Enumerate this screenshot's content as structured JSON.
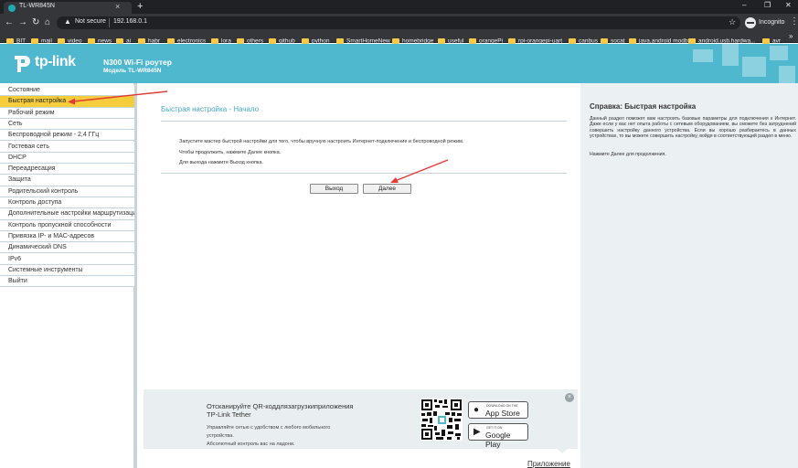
{
  "browser": {
    "tab_title": "TL-WR845N",
    "tab_close": "×",
    "new_tab": "+",
    "window_min": "–",
    "window_restore": "❐",
    "window_close": "✕",
    "security_label": "Not secure",
    "url": "192.168.0.1",
    "profile_label": "Incognito",
    "bookmarks": [
      "BIT",
      "mail",
      "video",
      "news",
      "ai",
      "habr",
      "electronics",
      "lora",
      "others",
      "github",
      "python",
      "SmartHomeNew",
      "homebridge",
      "useful",
      "orangePi",
      "rpi-orangepi-uart",
      "canbus",
      "socat",
      "java,android modbus",
      "android.usb.hardwa...",
      "avr"
    ],
    "bookmarks_more": "»"
  },
  "header": {
    "brand": "tp-link",
    "model_title": "N300 Wi-Fi роутер",
    "model_sub": "Модель TL-WR845N"
  },
  "sidebar": {
    "items": [
      {
        "label": "Состояние",
        "active": false
      },
      {
        "label": "Быстрая настройка",
        "active": true
      },
      {
        "label": "Рабочий режим",
        "active": false
      },
      {
        "label": "Сеть",
        "active": false
      },
      {
        "label": "Беспроводной режим - 2,4 ГГц",
        "active": false
      },
      {
        "label": "Гостевая сеть",
        "active": false
      },
      {
        "label": "DHCP",
        "active": false
      },
      {
        "label": "Переадресация",
        "active": false
      },
      {
        "label": "Защита",
        "active": false
      },
      {
        "label": "Родительский контроль",
        "active": false
      },
      {
        "label": "Контроль доступа",
        "active": false
      },
      {
        "label": "Дополнительные настройки маршрутизации",
        "active": false
      },
      {
        "label": "Контроль пропускной способности",
        "active": false
      },
      {
        "label": "Привязка IP- и MAC-адресов",
        "active": false
      },
      {
        "label": "Динамический DNS",
        "active": false
      },
      {
        "label": "IPv6",
        "active": false
      },
      {
        "label": "Системные инструменты",
        "active": false
      },
      {
        "label": "Выйти",
        "active": false
      }
    ]
  },
  "main": {
    "title": "Быстрая настройка - Начало",
    "para1": "Запустите мастер быстрой настройки для того, чтобы вручную настроить Интернет-подключение и беспроводной режим.",
    "para2": "Чтобы продолжить, нажмите Далее кнопка.",
    "para3": "Для выхода нажмите Выход кнопка.",
    "exit_button": "Выход",
    "next_button": "Далее"
  },
  "promo": {
    "title_line1": "Отсканируйте QR-коддлязагрузкиприложения",
    "title_line2": "TP-Link Tether",
    "desc_line1": "Управляйте сетью с удобством с любого мобильного",
    "desc_line2": "устройства.",
    "desc_line3": "Абсолютный контроль вас на ладони.",
    "appstore_small": "DOWNLOAD ON THE",
    "appstore_big": "App Store",
    "googleplay_small": "GET IT ON",
    "googleplay_big": "Google Play",
    "close": "×",
    "app_link": "Приложение"
  },
  "help": {
    "title": "Справка: Быстрая настройка",
    "text": "Данный раздел поможет вам настроить базовые параметры для подключения к Интернет. Даже если у вас нет опыта работы с сетевым оборудованием, вы сможете без затруднений совершить настройку данного устройства. Если вы хорошо разбираетесь в данных устройствах, то вы можете совершить настройку, войдя в соответствующий раздел в меню.",
    "hint": "Нажмите Далее для продолжения."
  },
  "colors": {
    "header": "#4fb8cf",
    "active_menu": "#f5cd3b",
    "annotation_arrow": "#e53935"
  }
}
